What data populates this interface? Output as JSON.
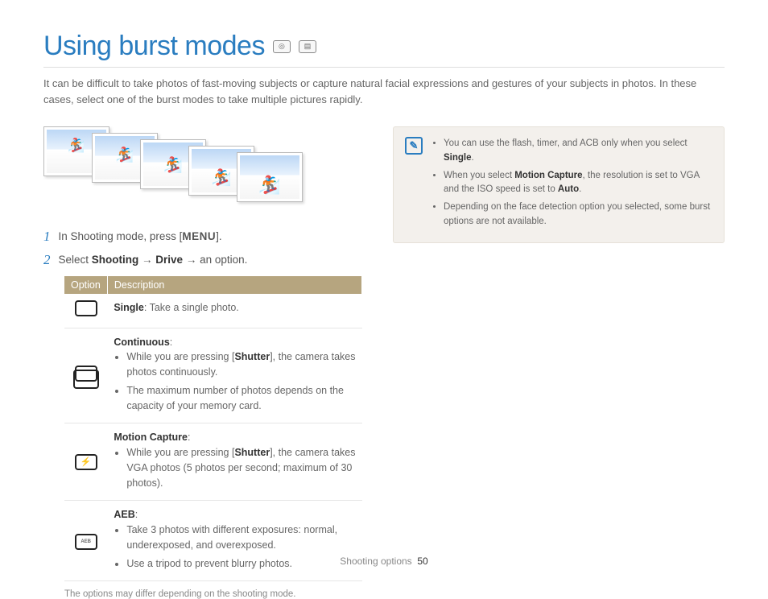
{
  "title": "Using burst modes",
  "intro": "It can be difficult to take photos of fast-moving subjects or capture natural facial expressions and gestures of your subjects in photos. In these cases, select one of the burst modes to take multiple pictures rapidly.",
  "steps": {
    "s1": {
      "num": "1",
      "pre": "In Shooting mode, press [",
      "menu": "MENU",
      "post": "]."
    },
    "s2": {
      "num": "2",
      "pre": "Select ",
      "b1": "Shooting",
      "arrow1": " → ",
      "b2": "Drive",
      "arrow2": " → an option."
    }
  },
  "table": {
    "h_option": "Option",
    "h_desc": "Description",
    "r1": {
      "title": "Single",
      "rest": ": Take a single photo."
    },
    "r2": {
      "title": "Continuous",
      "colon": ":",
      "b1a": "While you are pressing [",
      "shutter": "Shutter",
      "b1b": "], the camera takes photos continuously.",
      "b2": "The maximum number of photos depends on the capacity of your memory card."
    },
    "r3": {
      "title": "Motion Capture",
      "colon": ":",
      "b1a": "While you are pressing [",
      "shutter": "Shutter",
      "b1b": "], the camera takes VGA photos (5 photos per second; maximum of 30 photos)."
    },
    "r4": {
      "title": "AEB",
      "colon": ":",
      "b1": "Take 3 photos with different exposures: normal, underexposed, and overexposed.",
      "b2": "Use a tripod to prevent blurry photos."
    }
  },
  "footnote": "The options may differ depending on the shooting mode.",
  "note": {
    "n1a": "You can use the flash, timer, and ACB only when you select ",
    "n1b": "Single",
    "n1c": ".",
    "n2a": "When you select ",
    "n2b": "Motion Capture",
    "n2c": ", the resolution is set to VGA and the ISO speed is set to ",
    "n2d": "Auto",
    "n2e": ".",
    "n3": "Depending on the face detection option you selected, some burst options are not available."
  },
  "footer": {
    "section": "Shooting options",
    "page": "50"
  }
}
